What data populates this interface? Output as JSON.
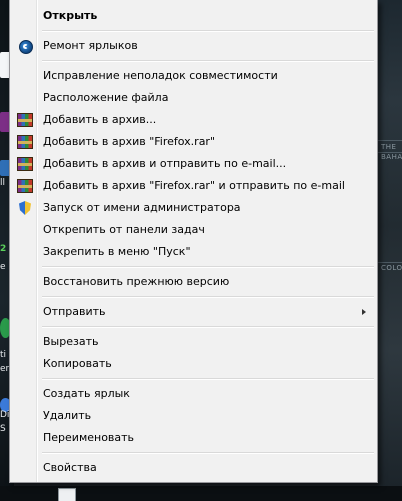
{
  "menu": {
    "items": [
      {
        "label": "Открыть",
        "bold": true
      },
      {
        "label": "Ремонт ярлыков",
        "icon": "repair-icon"
      },
      {
        "label": "Исправление неполадок совместимости"
      },
      {
        "label": "Расположение файла"
      },
      {
        "label": "Добавить в архив...",
        "icon": "winrar-icon"
      },
      {
        "label": "Добавить в архив \"Firefox.rar\"",
        "icon": "winrar-icon"
      },
      {
        "label": "Добавить в архив и отправить по e-mail...",
        "icon": "winrar-icon"
      },
      {
        "label": "Добавить в архив \"Firefox.rar\" и отправить по e-mail",
        "icon": "winrar-icon"
      },
      {
        "label": "Запуск от имени администратора",
        "icon": "admin-shield-icon"
      },
      {
        "label": "Открепить от панели задач"
      },
      {
        "label": "Закрепить в меню \"Пуск\""
      },
      {
        "label": "Восстановить прежнюю версию"
      },
      {
        "label": "Отправить",
        "submenu": true
      },
      {
        "label": "Вырезать"
      },
      {
        "label": "Копировать"
      },
      {
        "label": "Создать ярлык"
      },
      {
        "label": "Удалить"
      },
      {
        "label": "Переименовать"
      },
      {
        "label": "Свойства"
      }
    ]
  },
  "background": {
    "map_labels": [
      "THE",
      "BAHAMAS",
      "COLOMB"
    ],
    "left_fragments": [
      "ll",
      "2",
      "e",
      "ti",
      "en",
      "Di",
      "S"
    ]
  }
}
